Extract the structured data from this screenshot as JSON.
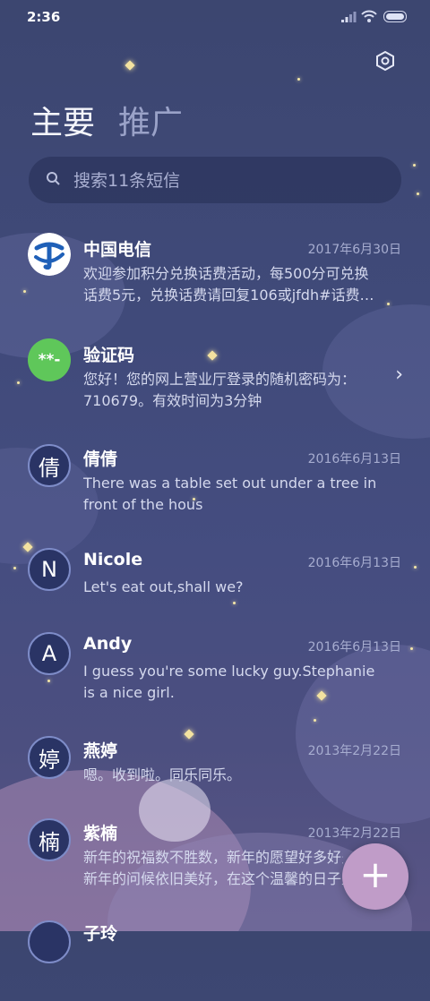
{
  "status": {
    "time": "2:36"
  },
  "settings_icon": "gear-icon",
  "tabs": [
    {
      "label": "主要",
      "active": true
    },
    {
      "label": "推广",
      "active": false
    }
  ],
  "search": {
    "placeholder": "搜索11条短信",
    "icon": "search-icon"
  },
  "conversations": [
    {
      "name": "中国电信",
      "date": "2017年6月30日",
      "line1": "欢迎参加积分兑换话费活动，每500分可兑换",
      "line2": "话费5元，兑换话费请回复106或jfdh#话费…",
      "avatar_color": "#1f60b8"
    },
    {
      "name": "验证码",
      "avatar": "**-",
      "line1": "您好！您的网上营业厅登录的随机密码为：",
      "line2": "710679。有效时间为3分钟",
      "avatar_color": "#5fc75a"
    },
    {
      "name": "倩倩",
      "avatar": "倩",
      "date": "2016年6月13日",
      "line1": "There was a table set out under a tree in",
      "line2": "front of the hous"
    },
    {
      "name": "Nicole",
      "avatar": "N",
      "date": "2016年6月13日",
      "line1": "Let's eat out,shall we?"
    },
    {
      "name": "Andy",
      "avatar": "A",
      "date": "2016年6月13日",
      "line1": "I guess you're some lucky guy.Stephanie",
      "line2": "is a nice girl."
    },
    {
      "name": "燕婷",
      "avatar": "婷",
      "date": "2013年2月22日",
      "line1": "嗯。收到啦。同乐同乐。"
    },
    {
      "name": "紫楠",
      "avatar": "楠",
      "date": "2013年2月22日",
      "line1": "新年的祝福数不胜数，新年的愿望好多好多，",
      "line2": "新年的问候依旧美好，在这个温馨的日子里…"
    },
    {
      "name": "子玲"
    }
  ],
  "fab": {
    "label": "+",
    "icon": "plus-icon"
  }
}
